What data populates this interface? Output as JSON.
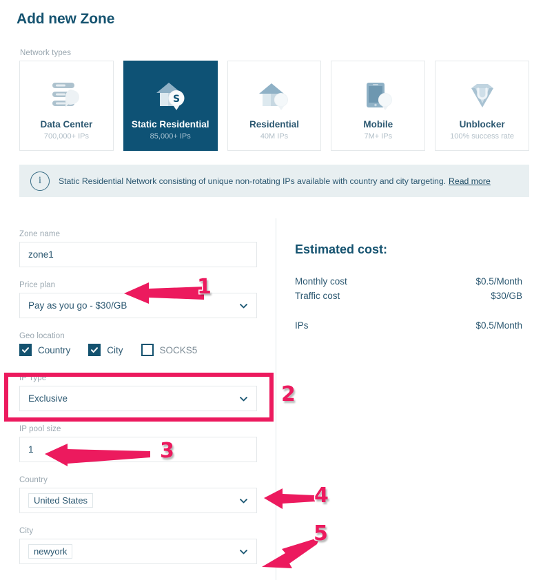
{
  "page": {
    "title": "Add new Zone"
  },
  "network_types": {
    "label": "Network types",
    "cards": [
      {
        "id": "data-center",
        "icon": "server-stack-icon",
        "title": "Data Center",
        "subtitle": "700,000+ IPs",
        "selected": false
      },
      {
        "id": "static-residential",
        "icon": "house-dollar-pin-icon",
        "title": "Static Residential",
        "subtitle": "85,000+ IPs",
        "selected": true
      },
      {
        "id": "residential",
        "icon": "house-pin-icon",
        "title": "Residential",
        "subtitle": "40M IPs",
        "selected": false
      },
      {
        "id": "mobile",
        "icon": "tablet-pin-icon",
        "title": "Mobile",
        "subtitle": "7M+ IPs",
        "selected": false
      },
      {
        "id": "unblocker",
        "icon": "diamond-icon",
        "title": "Unblocker",
        "subtitle": "100% success rate",
        "selected": false
      }
    ]
  },
  "info_banner": {
    "icon": "info-circle-icon",
    "text": "Static Residential Network consisting of unique non-rotating IPs available with country and city targeting.",
    "link_label": "Read more"
  },
  "form": {
    "zone_name": {
      "label": "Zone name",
      "value": "zone1",
      "placeholder": "Zone name"
    },
    "price_plan": {
      "label": "Price plan",
      "value": "Pay as you go - $30/GB"
    },
    "geo_location": {
      "label": "Geo location",
      "options": [
        {
          "label": "Country",
          "checked": true
        },
        {
          "label": "City",
          "checked": true
        },
        {
          "label": "SOCKS5",
          "checked": false
        }
      ]
    },
    "ip_type": {
      "label": "IP Type",
      "value": "Exclusive"
    },
    "ip_pool_size": {
      "label": "IP pool size",
      "value": "1",
      "placeholder": "IP pool size"
    },
    "country": {
      "label": "Country",
      "value": "United States"
    },
    "city": {
      "label": "City",
      "value": "newyork"
    }
  },
  "estimated_cost": {
    "title": "Estimated cost:",
    "rows": [
      {
        "label": "Monthly cost",
        "value": "$0.5/Month"
      },
      {
        "label": "Traffic cost",
        "value": "$30/GB"
      }
    ],
    "totals": [
      {
        "label": "IPs",
        "value": "$0.5/Month"
      }
    ]
  },
  "annotations": {
    "color": "#ec1a5e",
    "markers": [
      {
        "number": "1",
        "target": "price-plan-select"
      },
      {
        "number": "2",
        "target": "ip-type-select"
      },
      {
        "number": "3",
        "target": "ip-pool-size-input"
      },
      {
        "number": "4",
        "target": "country-select"
      },
      {
        "number": "5",
        "target": "city-select"
      }
    ]
  },
  "colors": {
    "brand_navy": "#0e5275",
    "accent_magenta": "#ec1a5e",
    "banner_bg": "#e8eff1",
    "text_muted": "#9aa7b0"
  }
}
